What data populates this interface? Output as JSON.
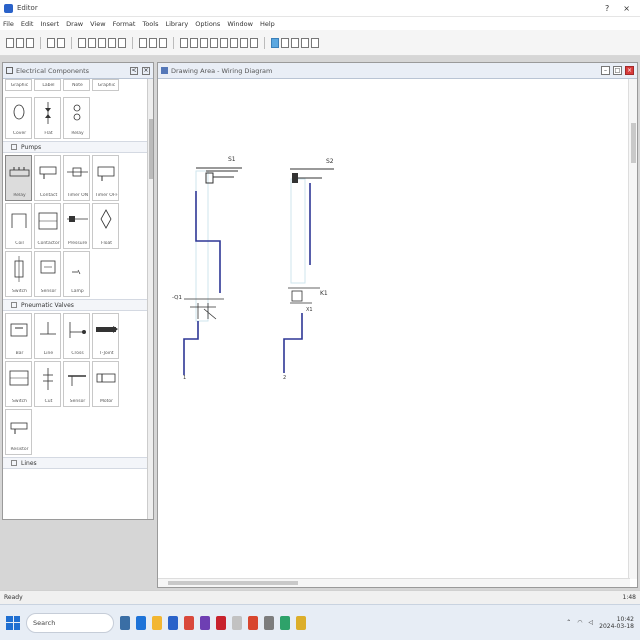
{
  "window": {
    "title": "Editor",
    "controls": [
      "?",
      "×"
    ]
  },
  "menu": [
    "File",
    "Edit",
    "Insert",
    "Draw",
    "View",
    "Format",
    "Tools",
    "Library",
    "Options",
    "Window",
    "Help"
  ],
  "panel": {
    "title": "Electrical Components",
    "buttons": [
      "<",
      "×"
    ],
    "top_captions": [
      "Graphic",
      "Label",
      "Note",
      "Graphic"
    ],
    "top_row2_captions": [
      "Cover",
      "Flat",
      "Relay"
    ],
    "categories": [
      {
        "name": "Pumps",
        "items": [
          "Relay",
          "Contact",
          "Timer ON",
          "Timer OFF",
          "Coil",
          "Contactor",
          "Pressure",
          "Float",
          "Switch",
          "Sensor",
          "Lamp"
        ]
      },
      {
        "name": "Pneumatic Valves",
        "items": [
          "Bar",
          "Line",
          "Cross",
          "T-Joint",
          "Switch",
          "Cut",
          "Sensor",
          "Motor",
          "Resistor"
        ]
      },
      {
        "name": "Lines",
        "items": []
      }
    ]
  },
  "document": {
    "title": "Drawing Area - Wiring Diagram",
    "controls": [
      "–",
      "□",
      "×"
    ]
  },
  "diagram": {
    "labels": [
      "S1",
      "S2",
      "X1",
      "K1",
      "-Q1",
      "1",
      "2"
    ]
  },
  "status": {
    "left": "Ready",
    "right": "1:48"
  },
  "taskbar": {
    "search_text": "Search",
    "app_colors": [
      "#3a6ea5",
      "#1e73d8",
      "#f2b632",
      "#2a62c9",
      "#d9483b",
      "#6e3fb3",
      "#c8222d",
      "#c2c2c2",
      "#d8462e",
      "#7d7d7d",
      "#2ea26a",
      "#dcae2a"
    ],
    "clock_time": "10:42",
    "clock_date": "2024-03-18"
  }
}
